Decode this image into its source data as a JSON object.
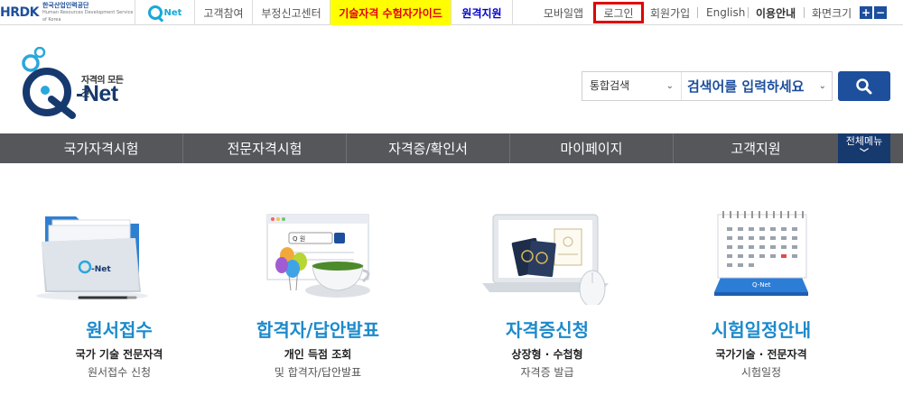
{
  "topbar": {
    "hrdk_mark": "HRDK",
    "hrdk_name": "한국산업인력공단",
    "hrdk_en": "Human Resources Development Service of Korea",
    "qnet_small": "Net",
    "links": {
      "customer": "고객참여",
      "report": "부정신고센터",
      "guide": "기술자격 수험자가이드",
      "remote": "원격지원",
      "mobile": "모바일앱",
      "login": "로그인",
      "join": "회원가입",
      "english": "English",
      "usage": "이용안내",
      "screen_size": "화면크기",
      "zoom_in": "+",
      "zoom_out": "−"
    }
  },
  "header": {
    "logo_slogan": "자격의 모든것",
    "logo_word": "-Net",
    "search": {
      "type_selected": "통합검색",
      "placeholder": "검색어를 입력하세요"
    }
  },
  "gnb": {
    "items": [
      "국가자격시험",
      "전문자격시험",
      "자격증/확인서",
      "마이페이지",
      "고객지원"
    ],
    "all_menu": "전체메뉴"
  },
  "quick_menu": [
    {
      "title": "원서접수",
      "sub1": "국가 기술 전문자격",
      "sub2": "원서접수 신청",
      "icon": "folder-icon"
    },
    {
      "title": "합격자/답안발표",
      "sub1": "개인 득점 조회",
      "sub2": "및 합격자/답안발표",
      "icon": "browser-teacup-icon"
    },
    {
      "title": "자격증신청",
      "sub1": "상장형 · 수첩형",
      "sub2": "자격증 발급",
      "icon": "laptop-passport-icon"
    },
    {
      "title": "시험일정안내",
      "sub1": "국가기술 · 전문자격",
      "sub2": "시험일정",
      "icon": "desk-calendar-icon"
    }
  ],
  "icon_labels": {
    "folder_brand": "-Net",
    "browser_search": "Q 원",
    "calendar_brand": "Q-Net"
  },
  "colors": {
    "brand_blue": "#1d4f9c",
    "accent_cyan": "#16a8d8",
    "title_blue": "#1d8acb",
    "gnb_bg": "#55575b",
    "guide_highlight": "#ffff00",
    "guide_text": "#e60012",
    "login_outline": "#e00000"
  }
}
